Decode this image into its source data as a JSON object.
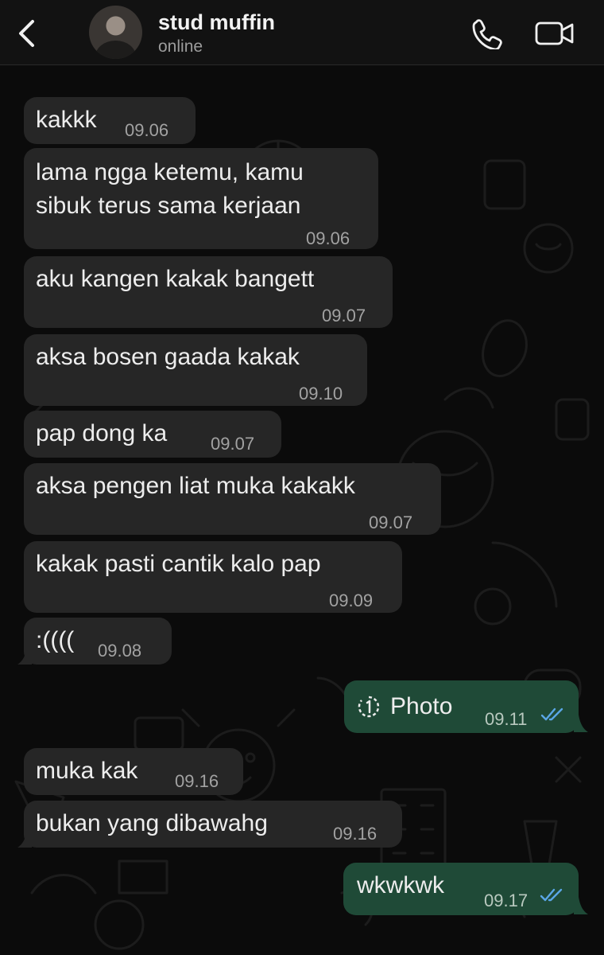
{
  "header": {
    "contact_name": "stud muffin",
    "status": "online",
    "icons": [
      "back-chevron-icon",
      "phone-icon",
      "video-camera-icon"
    ]
  },
  "messages": [
    {
      "text": "kakkk",
      "time": "09.06",
      "direction": "incoming"
    },
    {
      "text": "lama ngga ketemu, kamu\nsibuk terus sama kerjaan",
      "time": "09.06",
      "direction": "incoming"
    },
    {
      "text": "aku kangen kakak bangett",
      "time": "09.07",
      "direction": "incoming"
    },
    {
      "text": "aksa bosen gaada kakak",
      "time": "09.10",
      "direction": "incoming"
    },
    {
      "text": "pap dong ka",
      "time": "09.07",
      "direction": "incoming"
    },
    {
      "text": "aksa pengen liat muka kakakk",
      "time": "09.07",
      "direction": "incoming"
    },
    {
      "text": "kakak pasti cantik kalo pap",
      "time": "09.09",
      "direction": "incoming"
    },
    {
      "text": ":((((",
      "time": "09.08",
      "direction": "incoming"
    },
    {
      "text": "Photo",
      "time": "09.11",
      "direction": "outgoing",
      "icon": "view-once-icon",
      "read": true
    },
    {
      "text": "muka kak",
      "time": "09.16",
      "direction": "incoming"
    },
    {
      "text": "bukan yang dibawahg",
      "time": "09.16",
      "direction": "incoming"
    },
    {
      "text": "wkwkwk",
      "time": "09.17",
      "direction": "outgoing",
      "read": true
    }
  ],
  "colors": {
    "background": "#0b0b0b",
    "header": "#121212",
    "incoming_bubble": "#262626",
    "outgoing_bubble": "#1f4a37",
    "read_tick": "#5aa6e6"
  }
}
